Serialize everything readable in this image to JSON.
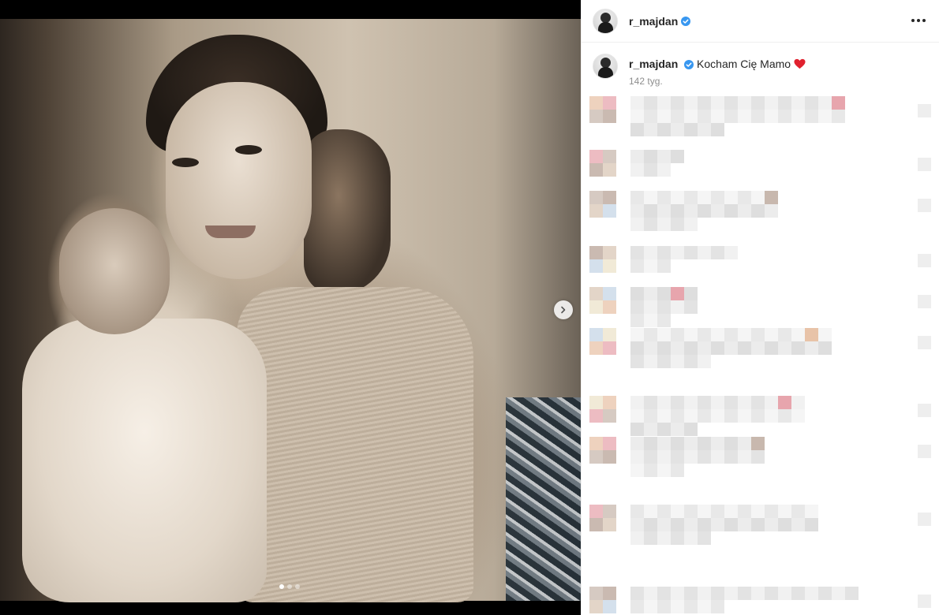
{
  "post": {
    "username": "r_majdan",
    "caption_text": "Kocham Cię Mamo",
    "timestamp": "142 tyg.",
    "carousel": {
      "count": 3,
      "active_index": 0
    }
  },
  "icons": {
    "verified": "verified-badge-icon",
    "more": "more-options-icon",
    "next": "chevron-right-icon",
    "heart": "red-heart-emoji"
  },
  "colors": {
    "verified_blue": "#3897f0",
    "heart_red": "#e0212e",
    "muted_text": "#8e8e8e",
    "text": "#262626"
  }
}
